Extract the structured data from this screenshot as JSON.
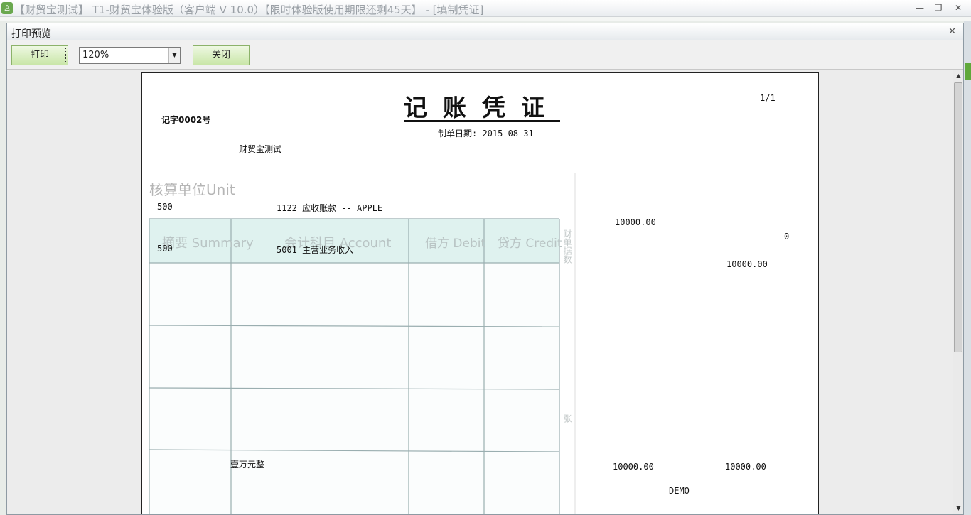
{
  "app": {
    "icon_glyph": "♙",
    "title": "【财贸宝测试】 T1-财贸宝体验版（客户端 V 10.0）【限时体验版使用期限还剩45天】 - [填制凭证]",
    "controls": [
      "—",
      "❐",
      "✕"
    ]
  },
  "dialog": {
    "title": "打印预览",
    "close_glyph": "✕"
  },
  "toolbar": {
    "print_label": "打印",
    "zoom_value": "120%",
    "zoom_arrow": "▼",
    "close_label": "关闭"
  },
  "scrollbar": {
    "up": "▲",
    "down": "▼"
  },
  "voucher": {
    "title": "记账凭证",
    "page": "1/1",
    "number": "记字0002号",
    "date": "制单日期: 2015-08-31",
    "company": "财贸宝测试",
    "unit_label": "核算单位Unit",
    "line1": {
      "summary": "500",
      "account": "1122  应收账款 -- APPLE",
      "debit": "10000.00",
      "credit": "0"
    },
    "line2": {
      "summary": "500",
      "account": "5001  主营业务收入",
      "credit": "10000.00"
    },
    "amount_words": "壹万元整",
    "total_debit": "10000.00",
    "total_credit": "10000.00",
    "maker": "DEMO",
    "headers": {
      "summary": "摘要 Summary",
      "account": "会计科目 Account",
      "debit": "借方 Debit",
      "credit": "贷方 Credit",
      "side_attach": "财单据数",
      "side_bottom": "张"
    }
  }
}
